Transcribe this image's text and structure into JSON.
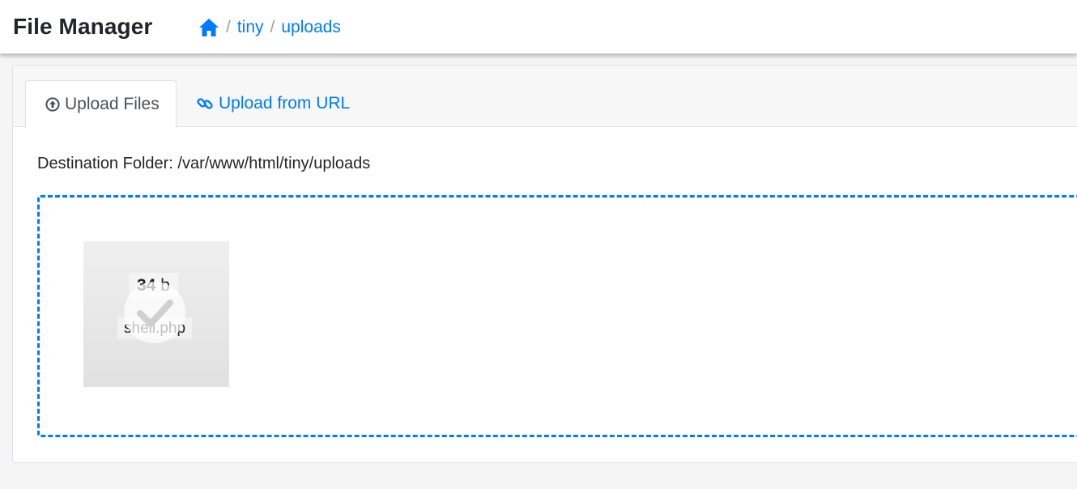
{
  "app": {
    "title": "File Manager"
  },
  "breadcrumb": {
    "items": [
      {
        "label": "tiny"
      },
      {
        "label": "uploads"
      }
    ],
    "separator": "/"
  },
  "tabs": {
    "upload_files": "Upload Files",
    "upload_url": "Upload from URL"
  },
  "destination": {
    "label": "Destination Folder: /var/www/html/tiny/uploads"
  },
  "dropzone": {
    "file": {
      "size_value": "34",
      "size_unit": "b",
      "name": "shell.php",
      "status": "success"
    }
  },
  "colors": {
    "accent": "#007bff",
    "success_icon": "#ffffff"
  },
  "icons": {
    "home": "home-icon",
    "upload": "upload-circle-icon",
    "link": "link-icon",
    "success": "checkmark-icon"
  }
}
